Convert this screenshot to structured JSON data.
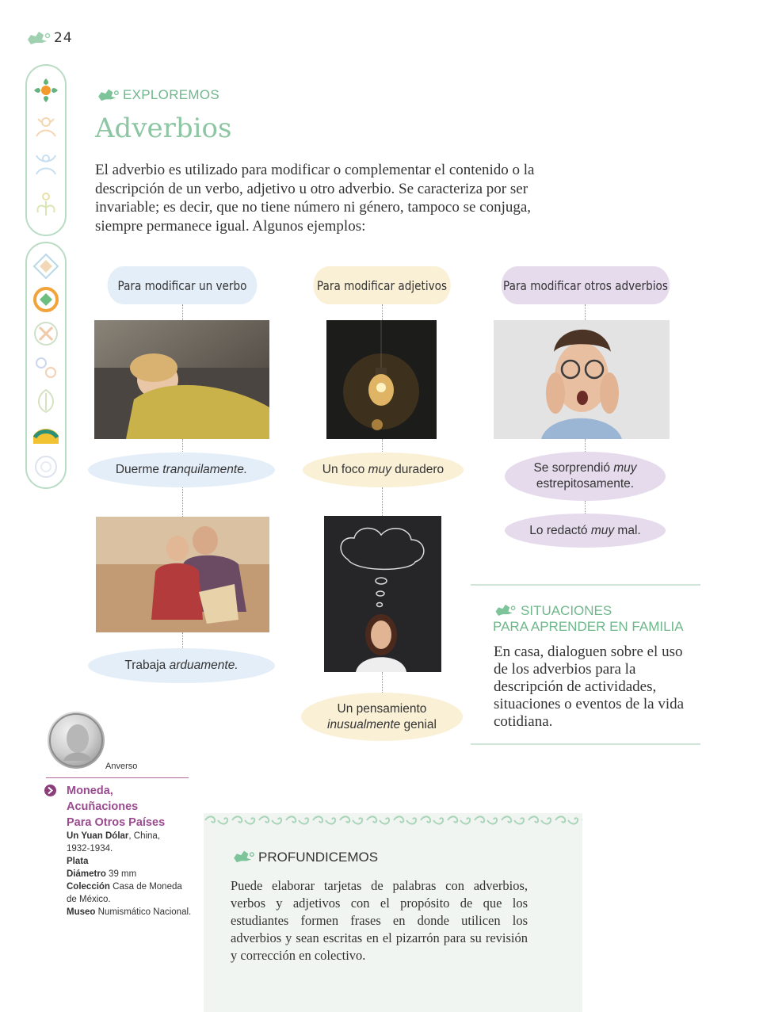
{
  "page_number": "24",
  "section_label": "EXPLOREMOS",
  "title": "Adverbios",
  "intro": "El adverbio es utilizado para modificar o complementar el contenido o la descripción de un verbo, adjetivo u otro adverbio. Se caracteriza por ser invariable; es decir, que no tiene número ni género, tampoco se conjuga, siempre permanece igual. Algunos ejemplos:",
  "categories": [
    {
      "label": "Para modificar un verbo",
      "color": "#e4eef8"
    },
    {
      "label": "Para modificar adjetivos",
      "color": "#faf0d6"
    },
    {
      "label": "Para modificar otros adverbios",
      "color": "#e6dbed"
    }
  ],
  "examples": {
    "verb_1": {
      "plain": "Duerme ",
      "italic": "tranquilamente."
    },
    "verb_2": {
      "plain": "Trabaja ",
      "italic": "arduamente."
    },
    "adj_1": {
      "pre": "Un foco ",
      "italic": "muy",
      "post": " duradero"
    },
    "adj_2": {
      "line1": "Un pensamiento",
      "italic": "inusualmente",
      "post": " genial"
    },
    "adv_1": {
      "pre": "Se sorprendió ",
      "italic": "muy",
      "line2": "estrepitosamente."
    },
    "adv_2": {
      "pre": "Lo redactó ",
      "italic": "muy",
      "post": " mal."
    }
  },
  "family": {
    "title_line1": "SITUACIONES",
    "title_line2": "PARA APRENDER EN FAMILIA",
    "text": "En casa, dialoguen sobre el uso de los adverbios para la descripción de actividades, situaciones o eventos de la vida cotidiana."
  },
  "coin": {
    "side_label": "Anverso",
    "title_line1": "Moneda,",
    "title_line2": "Acuñaciones",
    "title_line3": "Para Otros Países",
    "name_bold": "Un Yuan Dólar",
    "name_rest": ", China,",
    "years": "1932-1934.",
    "material": "Plata",
    "diameter_label": "Diámetro",
    "diameter_value": " 39 mm",
    "collection_label": "Colección",
    "collection_value": " Casa de Moneda de México.",
    "museum_label": "Museo",
    "museum_value": " Numismático Nacional."
  },
  "deepen": {
    "label": "PROFUNDICEMOS",
    "text": "Puede elaborar tarjetas de palabras con adverbios, verbos y adjetivos con el propósito de que los estudiantes formen frases en donde utilicen los adverbios y sean escritas en el pizarrón para su revisión y corrección en colectivo."
  },
  "colors": {
    "accent_green": "#6fb88c",
    "title_green": "#8cc6a2",
    "coin_purple": "#9a4a8e",
    "oval_blue": "#e4eef8",
    "oval_yellow": "#faf0d6",
    "oval_purple": "#e6dbed"
  }
}
